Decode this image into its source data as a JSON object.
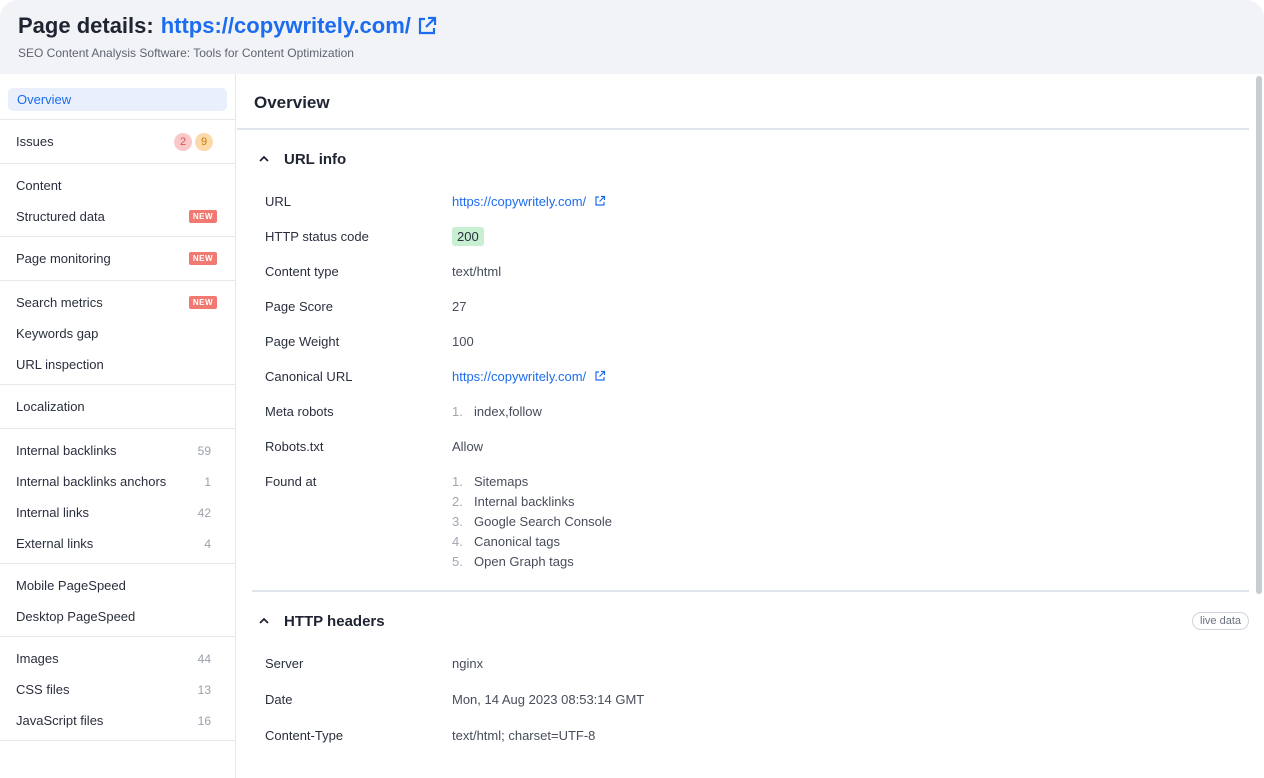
{
  "header": {
    "title_prefix": "Page details:",
    "title_url": "https://copywritely.com/",
    "subtitle": "SEO Content Analysis Software: Tools for Content Optimization"
  },
  "sidebar": {
    "overview": "Overview",
    "issues": {
      "label": "Issues",
      "errors": "2",
      "warnings": "9"
    },
    "content": "Content",
    "structured_data": {
      "label": "Structured data",
      "badge": "NEW"
    },
    "page_monitoring": {
      "label": "Page monitoring",
      "badge": "NEW"
    },
    "search_metrics": {
      "label": "Search metrics",
      "badge": "NEW"
    },
    "keywords_gap": "Keywords gap",
    "url_inspection": "URL inspection",
    "localization": "Localization",
    "internal_backlinks": {
      "label": "Internal backlinks",
      "count": "59"
    },
    "internal_backlinks_anchors": {
      "label": "Internal backlinks anchors",
      "count": "1"
    },
    "internal_links": {
      "label": "Internal links",
      "count": "42"
    },
    "external_links": {
      "label": "External links",
      "count": "4"
    },
    "mobile_pagespeed": "Mobile PageSpeed",
    "desktop_pagespeed": "Desktop PageSpeed",
    "images": {
      "label": "Images",
      "count": "44"
    },
    "css_files": {
      "label": "CSS files",
      "count": "13"
    },
    "javascript_files": {
      "label": "JavaScript files",
      "count": "16"
    }
  },
  "main": {
    "title": "Overview",
    "url_info": {
      "heading": "URL info",
      "url_label": "URL",
      "url_value": "https://copywritely.com/",
      "status_label": "HTTP status code",
      "status_value": "200",
      "content_type_label": "Content type",
      "content_type_value": "text/html",
      "page_score_label": "Page Score",
      "page_score_value": "27",
      "page_weight_label": "Page Weight",
      "page_weight_value": "100",
      "canonical_label": "Canonical URL",
      "canonical_value": "https://copywritely.com/",
      "meta_robots_label": "Meta robots",
      "meta_robots": [
        {
          "n": "1.",
          "v": "index,follow"
        }
      ],
      "robots_label": "Robots.txt",
      "robots_value": "Allow",
      "found_at_label": "Found at",
      "found_at": [
        {
          "n": "1.",
          "v": "Sitemaps"
        },
        {
          "n": "2.",
          "v": "Internal backlinks"
        },
        {
          "n": "3.",
          "v": "Google Search Console"
        },
        {
          "n": "4.",
          "v": "Canonical tags"
        },
        {
          "n": "5.",
          "v": "Open Graph tags"
        }
      ]
    },
    "http_headers": {
      "heading": "HTTP headers",
      "live": "live data",
      "server_label": "Server",
      "server_value": "nginx",
      "date_label": "Date",
      "date_value": "Mon, 14 Aug 2023 08:53:14 GMT",
      "ctype_label": "Content-Type",
      "ctype_value": "text/html; charset=UTF-8"
    }
  },
  "colors": {
    "accent": "#1c6cf0",
    "badge_new": "#f07a72",
    "status_ok": "#c9efd2"
  }
}
